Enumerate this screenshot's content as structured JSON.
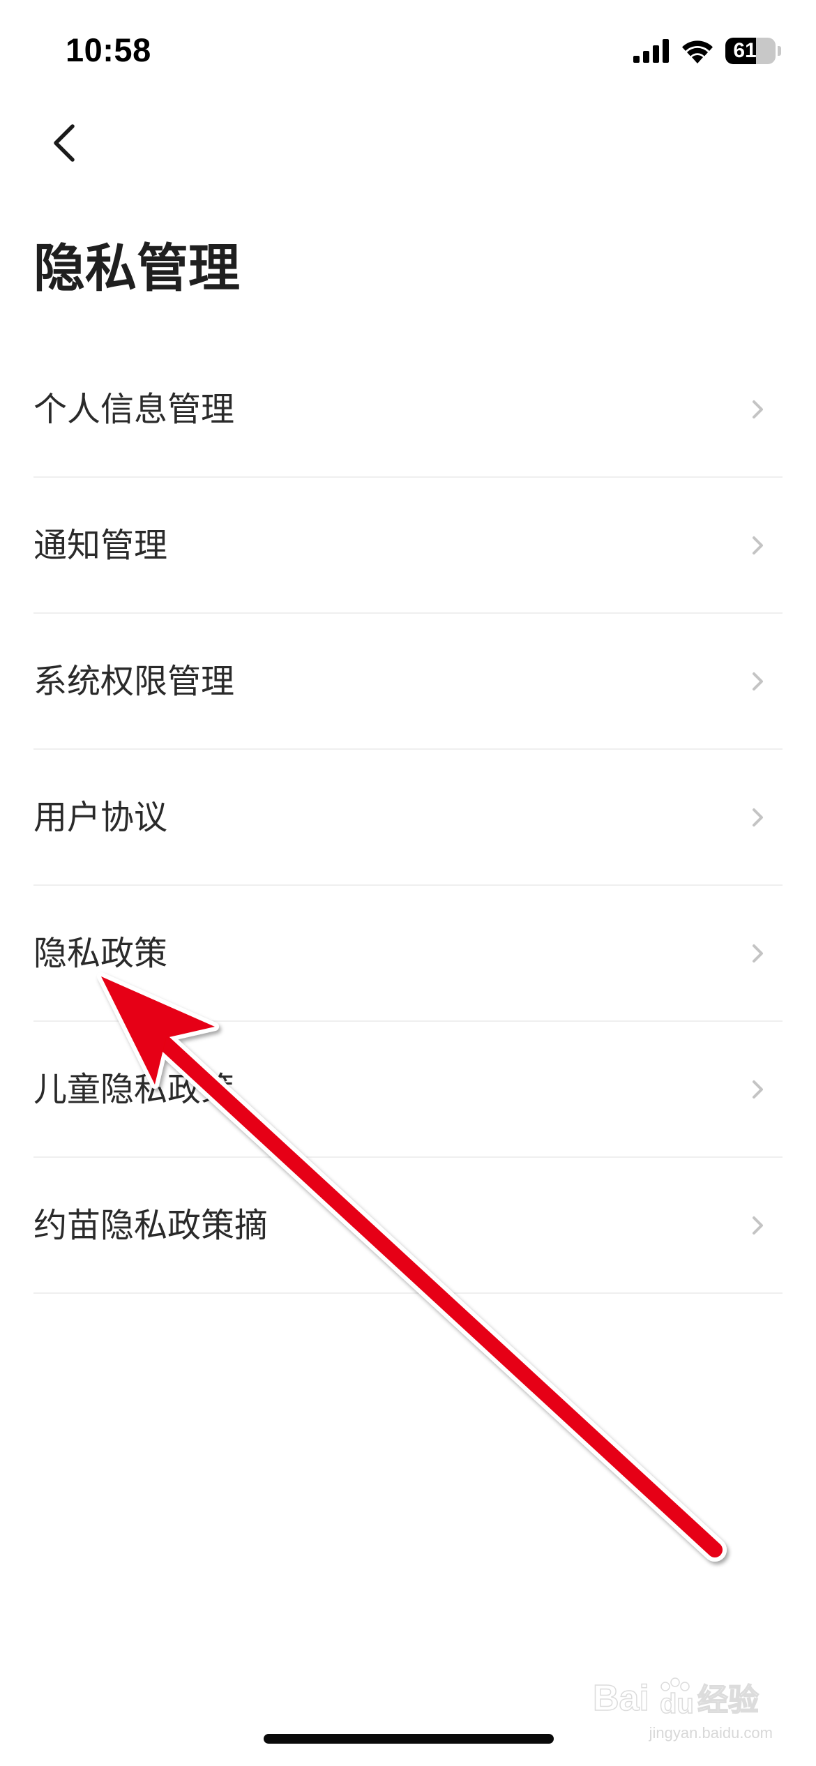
{
  "status_bar": {
    "time": "10:58",
    "battery_level": "61",
    "battery_fraction": 0.61,
    "icons": [
      "signal-icon",
      "wifi-icon",
      "battery-icon"
    ]
  },
  "nav": {
    "back_icon": "chevron-left-icon"
  },
  "page": {
    "title": "隐私管理"
  },
  "menu": {
    "items": [
      {
        "label": "个人信息管理"
      },
      {
        "label": "通知管理"
      },
      {
        "label": "系统权限管理"
      },
      {
        "label": "用户协议"
      },
      {
        "label": "隐私政策"
      },
      {
        "label": "儿童隐私政策"
      },
      {
        "label": "约苗隐私政策摘"
      }
    ],
    "chevron_icon": "chevron-right-icon"
  },
  "annotation": {
    "arrow_color": "#e60012",
    "target": "隐私政策"
  },
  "watermark": {
    "logo": "Baidu 经验",
    "url": "jingyan.baidu.com"
  },
  "colors": {
    "background": "#ffffff",
    "text_primary": "#1f1f1f",
    "divider": "#efefef",
    "chevron": "#c4c4c4"
  }
}
